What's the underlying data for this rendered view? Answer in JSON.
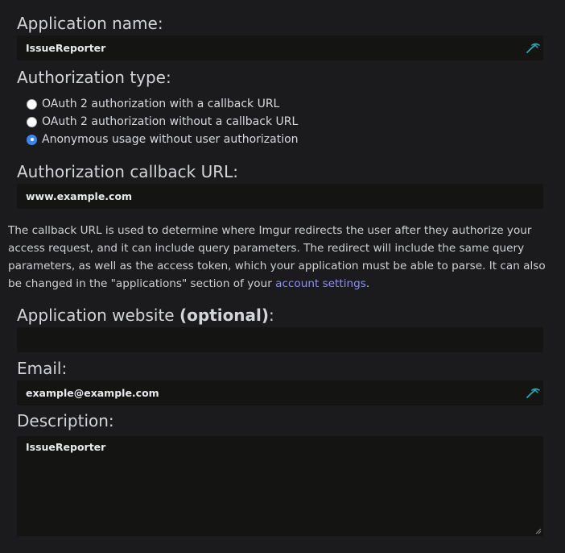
{
  "app_name": {
    "label": "Application name:",
    "value": "IssueReporter"
  },
  "auth_type": {
    "label": "Authorization type:",
    "options": [
      {
        "label": "OAuth 2 authorization with a callback URL",
        "selected": false
      },
      {
        "label": "OAuth 2 authorization without a callback URL",
        "selected": false
      },
      {
        "label": "Anonymous usage without user authorization",
        "selected": true
      }
    ]
  },
  "callback": {
    "label": "Authorization callback URL:",
    "value": "www.example.com",
    "help_before": "The callback URL is used to determine where Imgur redirects the user after they authorize your access request, and it can include query parameters. The redirect will include the same query parameters, as well as the access token, which your application must be able to parse. It can also be changed in the \"applications\" section of your ",
    "help_link": "account settings",
    "help_after": "."
  },
  "website": {
    "label_main": "Application website ",
    "label_optional": "(optional)",
    "label_suffix": ":",
    "value": ""
  },
  "email": {
    "label": "Email:",
    "value": "example@example.com"
  },
  "description": {
    "label": "Description:",
    "value": "IssueReporter"
  },
  "colors": {
    "background": "#1b1b1d",
    "field_bg": "#141413",
    "link": "#8e8ef5",
    "radio_checked": "#3c86f2",
    "autofill_icon": "#2aa7b8"
  },
  "icons": {
    "autofill": "autofill-key-icon",
    "resize": "resize-grip-icon"
  }
}
